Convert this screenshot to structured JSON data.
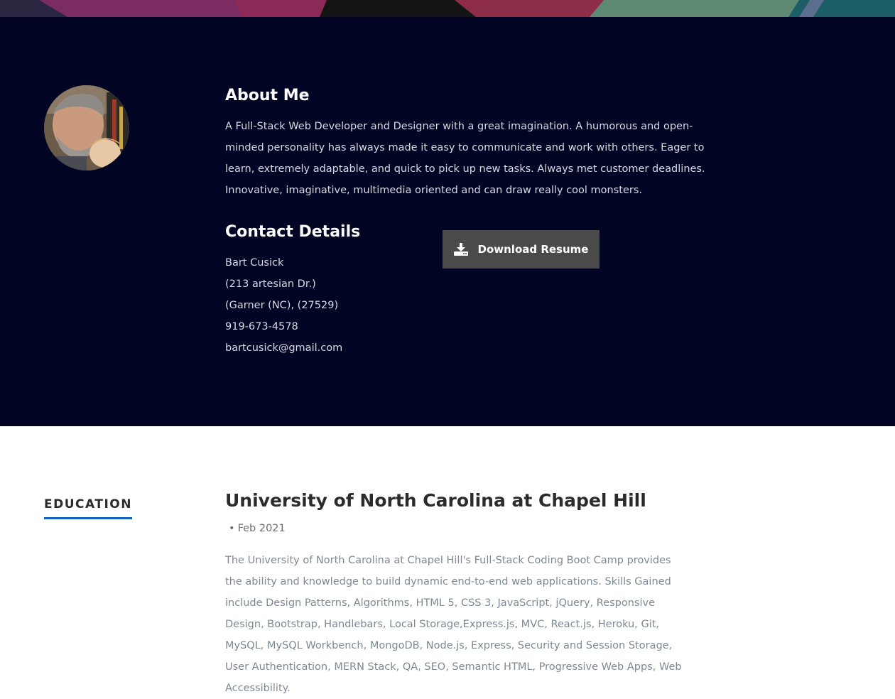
{
  "about": {
    "heading": "About Me",
    "text": "A Full-Stack Web Developer and Designer with a great imagination. A humorous and open-minded personality has always made it easy to communicate and work with others. Eager to learn, extremely adaptable, and quick to pick up new tasks. Always met customer deadlines. Innovative, imaginative, multimedia oriented and can draw really cool monsters."
  },
  "contact": {
    "heading": "Contact Details",
    "name": "Bart Cusick",
    "street": "(213 artesian Dr.)",
    "city": "(Garner (NC), (27529)",
    "phone": "919-673-4578",
    "email": "bartcusick@gmail.com"
  },
  "download_button": {
    "label": "Download Resume",
    "icon": "download-icon"
  },
  "education": {
    "section_label": "EDUCATION",
    "school": "University of North Carolina at Chapel Hill",
    "bullet": "•",
    "date": "Feb 2021",
    "description": "The University of North Carolina at Chapel Hill's Full-Stack Coding Boot Camp provides the ability and knowledge to build dynamic end-to-end web applications. Skills Gained include Design Patterns, Algorithms, HTML 5, CSS 3, JavaScript, jQuery, Responsive Design, Bootstrap, Handlebars, Local Storage,Express.js, MVC, React.js, Heroku, Git, MySQL, MySQL Workbench, MongoDB, Node.js, Express, Security and Session Storage, User Authentication, MERN Stack, QA, SEO, Semantic HTML, Progressive Web Apps, Web Accessibility."
  },
  "colors": {
    "about_background": "#020424",
    "button_background": "#4a4a4a",
    "accent_underline": "#1565c0"
  }
}
